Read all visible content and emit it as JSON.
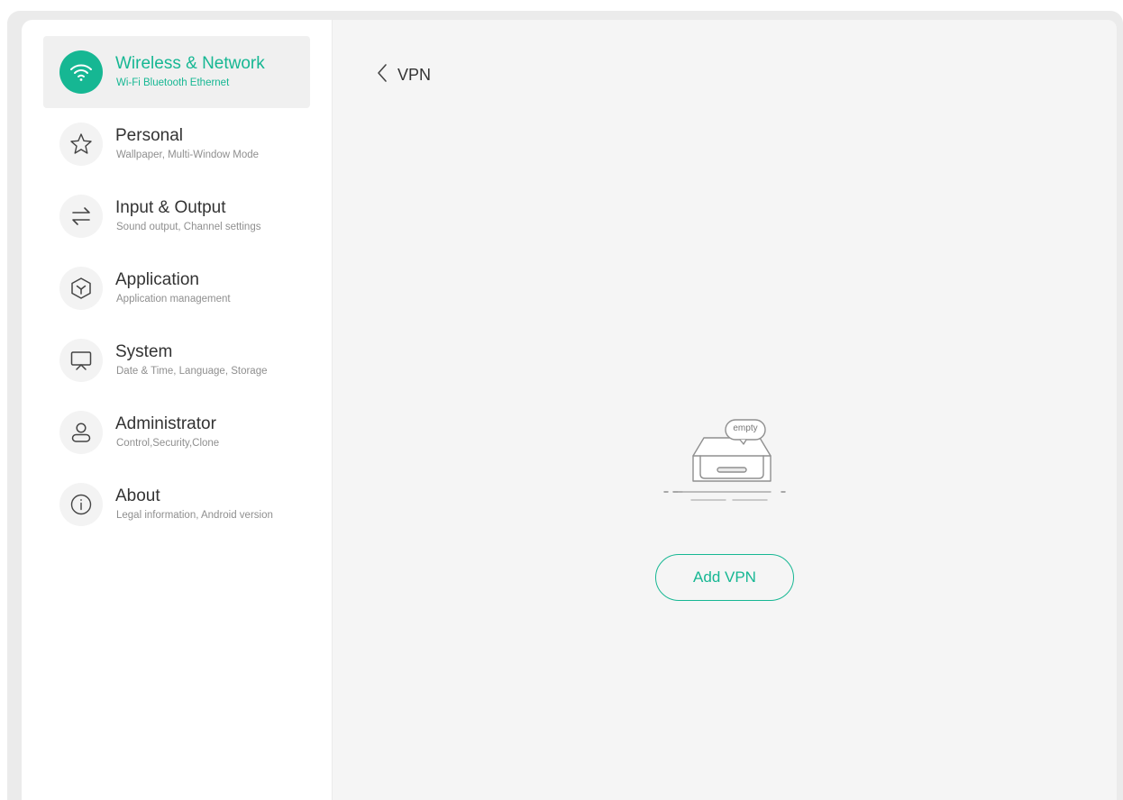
{
  "sidebar": {
    "items": [
      {
        "title": "Wireless & Network",
        "subtitle": "Wi-Fi Bluetooth Ethernet",
        "icon": "wifi-icon",
        "active": true
      },
      {
        "title": "Personal",
        "subtitle": "Wallpaper, Multi-Window Mode",
        "icon": "star-icon",
        "active": false
      },
      {
        "title": "Input & Output",
        "subtitle": "Sound output, Channel settings",
        "icon": "swap-arrows-icon",
        "active": false
      },
      {
        "title": "Application",
        "subtitle": "Application management",
        "icon": "cube-icon",
        "active": false
      },
      {
        "title": "System",
        "subtitle": "Date & Time, Language, Storage",
        "icon": "monitor-icon",
        "active": false
      },
      {
        "title": "Administrator",
        "subtitle": "Control,Security,Clone",
        "icon": "user-icon",
        "active": false
      },
      {
        "title": "About",
        "subtitle": "Legal information, Android version",
        "icon": "info-icon",
        "active": false
      }
    ]
  },
  "main": {
    "back_icon": "chevron-left-icon",
    "title": "VPN",
    "empty_label": "empty",
    "add_button_label": "Add VPN"
  },
  "colors": {
    "accent": "#16b793",
    "page_background": "#f5f5f5",
    "sidebar_background": "#ffffff",
    "text_primary": "#333333",
    "text_secondary": "#8f8f8f"
  }
}
